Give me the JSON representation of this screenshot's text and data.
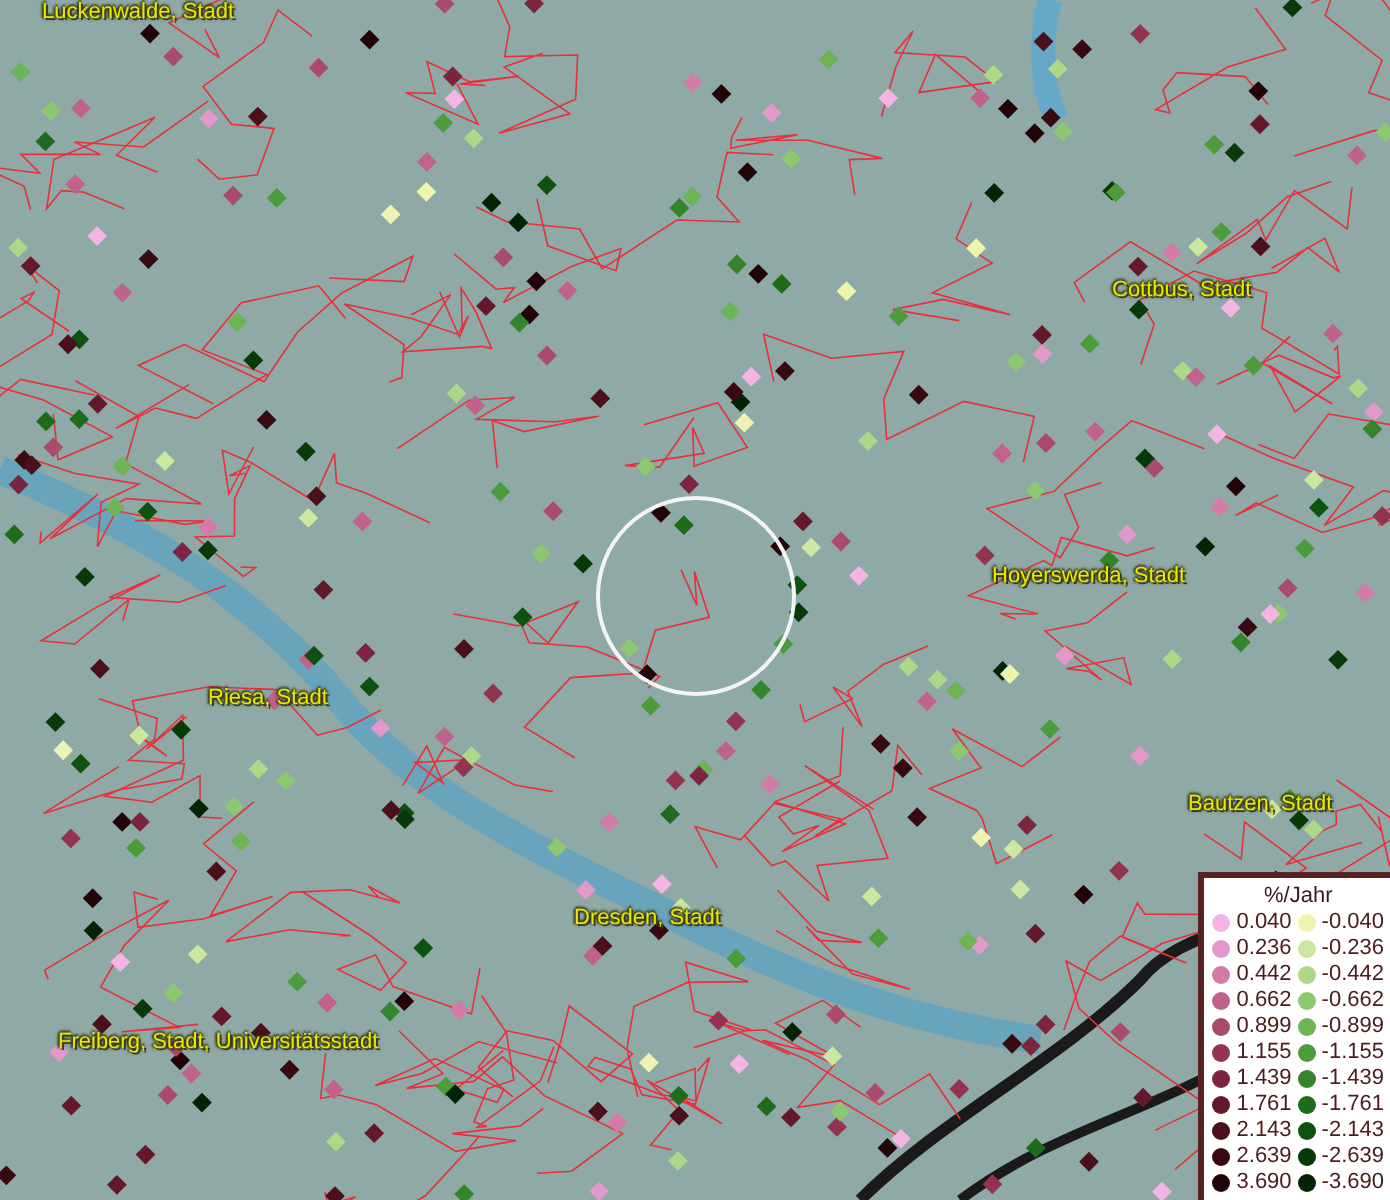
{
  "places": [
    {
      "name": "Luckenwalde, Stadt"
    },
    {
      "name": "Cottbus, Stadt"
    },
    {
      "name": "Hoyerswerda, Stadt"
    },
    {
      "name": "Riesa, Stadt"
    },
    {
      "name": "Bautzen, Stadt"
    },
    {
      "name": "Dresden, Stadt"
    },
    {
      "name": "Freiberg, Stadt, Universitätsstadt"
    }
  ],
  "legend": {
    "title": "%/Jahr",
    "positive": [
      {
        "label": "0.040",
        "color": "#f4b4e4"
      },
      {
        "label": "0.236",
        "color": "#e298c8"
      },
      {
        "label": "0.442",
        "color": "#d27aa8"
      },
      {
        "label": "0.662",
        "color": "#c0628c"
      },
      {
        "label": "0.899",
        "color": "#aa4a6c"
      },
      {
        "label": "1.155",
        "color": "#923450"
      },
      {
        "label": "1.439",
        "color": "#7c2440"
      },
      {
        "label": "1.761",
        "color": "#64182c"
      },
      {
        "label": "2.143",
        "color": "#4c101c"
      },
      {
        "label": "2.639",
        "color": "#360a10"
      },
      {
        "label": "3.690",
        "color": "#220408"
      }
    ],
    "negative": [
      {
        "label": "-0.040",
        "color": "#eef4b0"
      },
      {
        "label": "-0.236",
        "color": "#cce8a0"
      },
      {
        "label": "-0.442",
        "color": "#acd888"
      },
      {
        "label": "-0.662",
        "color": "#8cc870"
      },
      {
        "label": "-0.899",
        "color": "#6cb454"
      },
      {
        "label": "-1.155",
        "color": "#4c9c3c"
      },
      {
        "label": "-1.439",
        "color": "#34842c"
      },
      {
        "label": "-1.761",
        "color": "#1c6c1c"
      },
      {
        "label": "-2.143",
        "color": "#0e5210"
      },
      {
        "label": "-2.639",
        "color": "#083a08"
      },
      {
        "label": "-3.690",
        "color": "#042204"
      }
    ]
  }
}
